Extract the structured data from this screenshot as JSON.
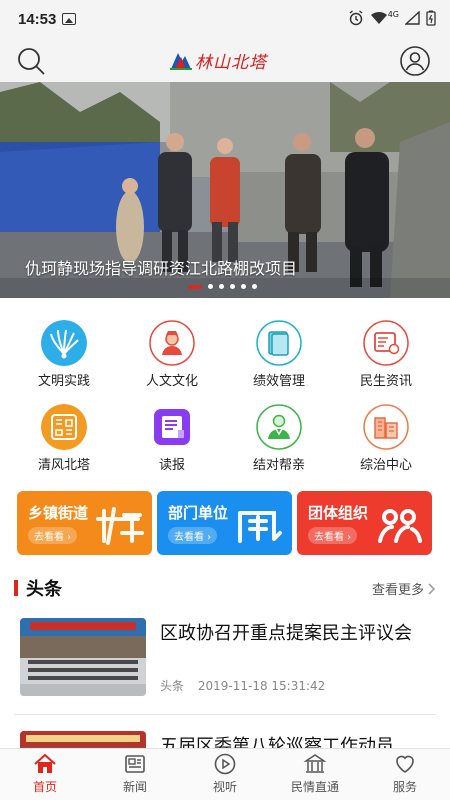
{
  "status_bar": {
    "time": "14:53",
    "signal_label": "4G"
  },
  "header": {
    "logo_text": "林山北塔"
  },
  "banner": {
    "caption": "仇珂静现场指导调研资江北路棚改项目",
    "slide_count": 6,
    "active_slide": 1
  },
  "grid": {
    "items": [
      {
        "label": "文明实践",
        "icon": "peacock-icon"
      },
      {
        "label": "人文文化",
        "icon": "person-icon"
      },
      {
        "label": "绩效管理",
        "icon": "book-icon"
      },
      {
        "label": "民生资讯",
        "icon": "id-card-icon"
      },
      {
        "label": "清风北塔",
        "icon": "seal-icon"
      },
      {
        "label": "读报",
        "icon": "newspaper-icon"
      },
      {
        "label": "结对帮亲",
        "icon": "helper-icon"
      },
      {
        "label": "综治中心",
        "icon": "buildings-icon"
      }
    ]
  },
  "cards": [
    {
      "title": "乡镇街道",
      "sub": "去看看 ›",
      "color": "#f38a1a"
    },
    {
      "title": "部门单位",
      "sub": "去看看 ›",
      "color": "#1a8ff0"
    },
    {
      "title": "团体组织",
      "sub": "去看看 ›",
      "color": "#ef3b2e"
    }
  ],
  "headlines": {
    "title": "头条",
    "more_label": "查看更多",
    "items": [
      {
        "title": "区政协召开重点提案民主评议会",
        "tag": "头条",
        "time": "2019-11-18 15:31:42"
      },
      {
        "title": "五届区委第八轮巡察工作动员"
      }
    ]
  },
  "bottom_nav": {
    "items": [
      {
        "label": "首页",
        "active": true
      },
      {
        "label": "新闻",
        "active": false
      },
      {
        "label": "视听",
        "active": false
      },
      {
        "label": "民情直通",
        "active": false
      },
      {
        "label": "服务",
        "active": false
      }
    ]
  },
  "colors": {
    "accent": "#e3261d",
    "nav_active": "#e3261d"
  }
}
